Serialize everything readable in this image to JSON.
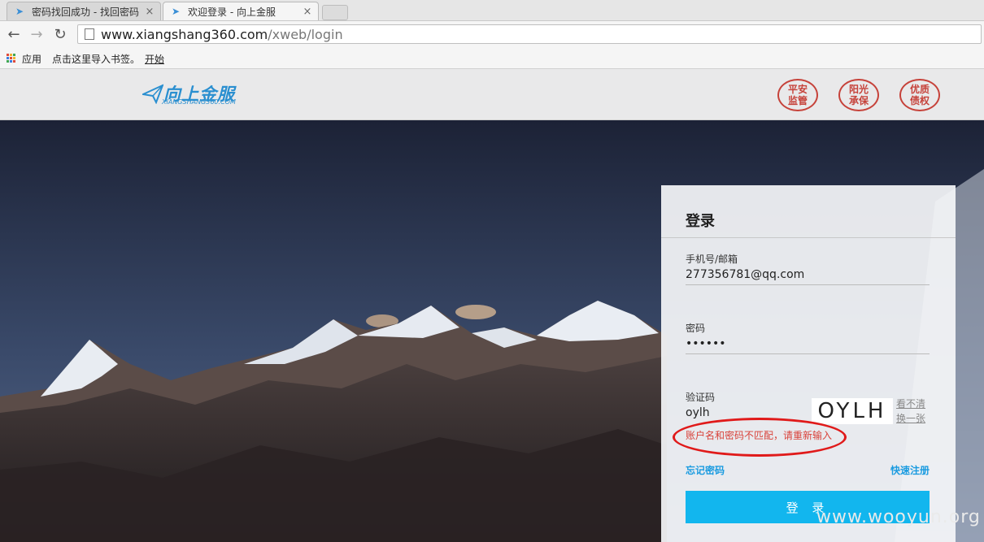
{
  "browser": {
    "tabs": [
      {
        "title": "密码找回成功 - 找回密码",
        "active": false
      },
      {
        "title": "欢迎登录 - 向上金服",
        "active": true
      }
    ],
    "url_host": "www.xiangshang360.com",
    "url_path": "/xweb/login",
    "bookmarks": {
      "apps": "应用",
      "import": "点击这里导入书签。",
      "start": "开始"
    }
  },
  "site": {
    "logo_text": "向上金服",
    "logo_sub": "XIANGSHANG360.COM",
    "badges": [
      {
        "line1": "平安",
        "line2": "监管"
      },
      {
        "line1": "阳光",
        "line2": "承保"
      },
      {
        "line1": "优质",
        "line2": "债权"
      }
    ]
  },
  "login": {
    "heading": "登录",
    "account_label": "手机号/邮箱",
    "account_value": "277356781@qq.com",
    "password_label": "密码",
    "password_value": "••••••",
    "captcha_label": "验证码",
    "captcha_value": "oylh",
    "captcha_image_text": "OYLH",
    "refresh_text": "看不清换一张",
    "error_message": "账户名和密码不匹配，请重新输入",
    "forgot_link": "忘记密码",
    "register_link": "快速注册",
    "submit_label": "登 录"
  },
  "watermark": "www.wooyun.org",
  "colors": {
    "accent": "#12b6ee",
    "error": "#d9423a",
    "badge": "#c6423a",
    "logo": "#2a8fd0"
  }
}
